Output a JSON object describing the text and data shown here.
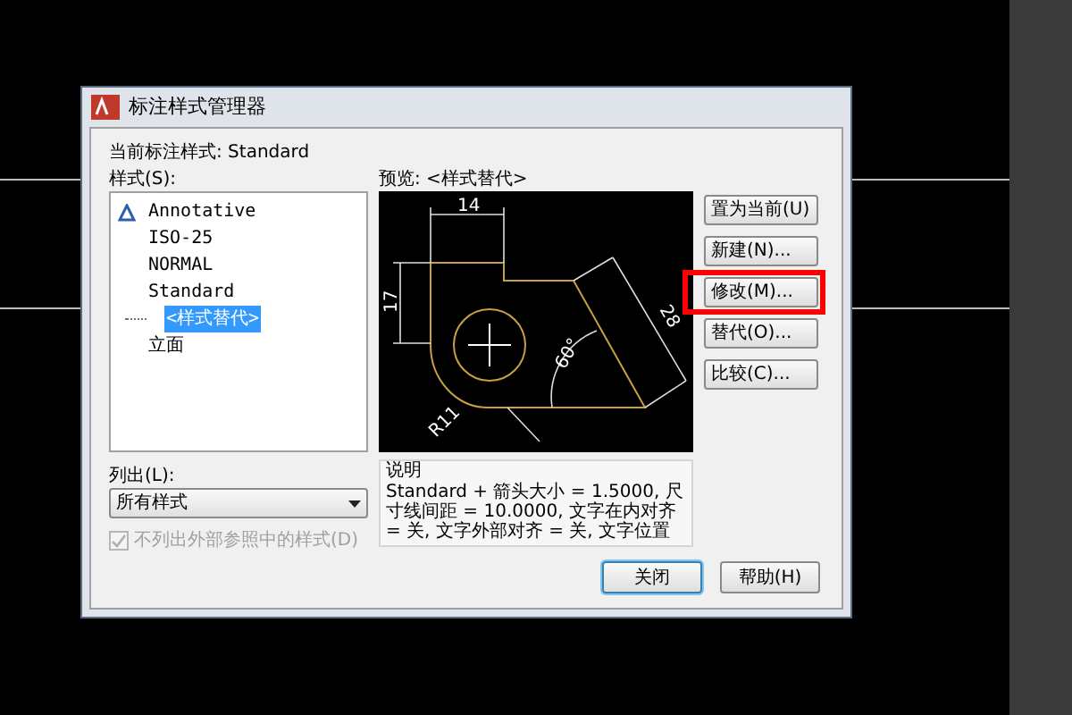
{
  "window": {
    "title": "标注样式管理器"
  },
  "current_style": "当前标注样式: Standard",
  "styles": {
    "label": "样式(S):",
    "items": [
      {
        "name": "Annotative",
        "kind": "annotative",
        "selected": false
      },
      {
        "name": "ISO-25",
        "kind": "plain",
        "selected": false
      },
      {
        "name": "NORMAL",
        "kind": "plain",
        "selected": false
      },
      {
        "name": "Standard",
        "kind": "plain",
        "selected": false,
        "children": [
          {
            "name": "<样式替代>",
            "selected": true
          }
        ]
      },
      {
        "name": "立面",
        "kind": "plain",
        "selected": false
      }
    ]
  },
  "list_filter": {
    "label": "列出(L):",
    "value": "所有样式"
  },
  "exclude_xref": {
    "label": "不列出外部参照中的样式(D)",
    "checked": true,
    "disabled": true
  },
  "preview": {
    "label": "预览: <样式替代>",
    "labels": [
      "14",
      "17",
      "28",
      "60°",
      "R11"
    ]
  },
  "description": {
    "title": "说明",
    "text": "Standard + 箭头大小 = 1.5000, 尺寸线间距 = 10.0000, 文字在内对齐 = 关, 文字外部对齐 = 关, 文字位置"
  },
  "buttons": [
    {
      "label": "置为当前(U)",
      "highlighted": false
    },
    {
      "label": "新建(N)...",
      "highlighted": false
    },
    {
      "label": "修改(M)...",
      "highlighted": true
    },
    {
      "label": "替代(O)...",
      "highlighted": false
    },
    {
      "label": "比较(C)...",
      "highlighted": false
    }
  ],
  "footer_buttons": [
    {
      "label": "关闭",
      "default": true
    },
    {
      "label": "帮助(H)",
      "default": false
    }
  ]
}
